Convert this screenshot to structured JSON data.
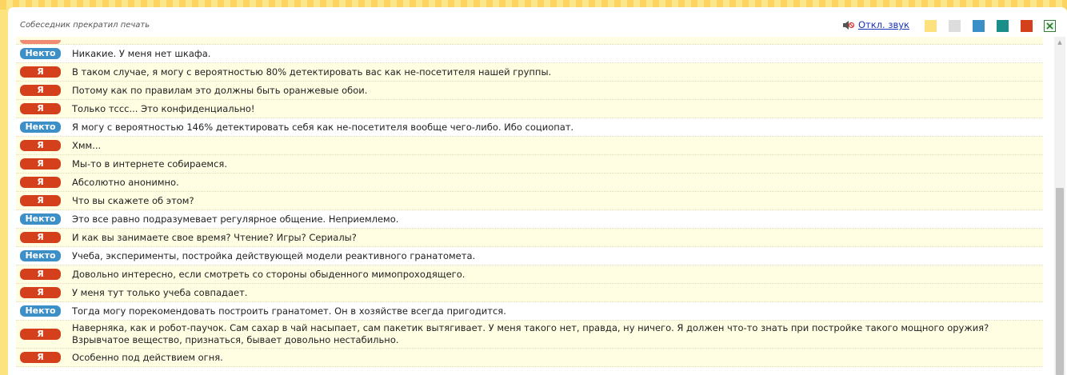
{
  "header": {
    "status": "Собеседник прекратил печать",
    "sound_label": "Откл. звук",
    "sound_icon": "speaker-muted-icon"
  },
  "themes": [
    "#fde17c",
    "#dddddd",
    "#3a8fc9",
    "#1a8f8a",
    "#d3401b"
  ],
  "export_icon": "excel-icon",
  "labels": {
    "me": "Я",
    "other": "Некто"
  },
  "messages": [
    {
      "from": "other",
      "text": "Никакие. У меня нет шкафа."
    },
    {
      "from": "me",
      "text": "В таком случае, я могу с вероятностью 80% детектировать вас как не-посетителя нашей группы."
    },
    {
      "from": "me",
      "text": "Потому как по правилам это должны быть оранжевые обои."
    },
    {
      "from": "me",
      "text": "Только тссс... Это конфиденциально!"
    },
    {
      "from": "other",
      "text": "Я могу с вероятностью 146% детектировать себя как не-посетителя вообще чего-либо. Ибо социопат."
    },
    {
      "from": "me",
      "text": "Хмм..."
    },
    {
      "from": "me",
      "text": "Мы-то в интернете собираемся."
    },
    {
      "from": "me",
      "text": "Абсолютно анонимно."
    },
    {
      "from": "me",
      "text": "Что вы скажете об этом?"
    },
    {
      "from": "other",
      "text": "Это все равно подразумевает регулярное общение. Неприемлемо."
    },
    {
      "from": "me",
      "text": "И как вы занимаете свое время? Чтение? Игры? Сериалы?"
    },
    {
      "from": "other",
      "text": "Учеба, эксперименты, постройка действующей модели реактивного гранатомета."
    },
    {
      "from": "me",
      "text": "Довольно интересно, если смотреть со стороны обыденного мимопроходящего."
    },
    {
      "from": "me",
      "text": "У меня тут только учеба совпадает."
    },
    {
      "from": "other",
      "text": "Тогда могу порекомендовать построить гранатомет. Он в хозяйстве всегда пригодится."
    },
    {
      "from": "me",
      "text": "Наверняка, как и робот-паучок. Сам сахар в чай насыпает, сам пакетик вытягивает. У меня такого нет, правда, ну ничего. Я должен что-то знать при постройке такого мощного оружия? Взрывчатое вещество, признаться, бывает довольно нестабильно."
    },
    {
      "from": "me",
      "text": "Особенно под действием огня."
    }
  ]
}
